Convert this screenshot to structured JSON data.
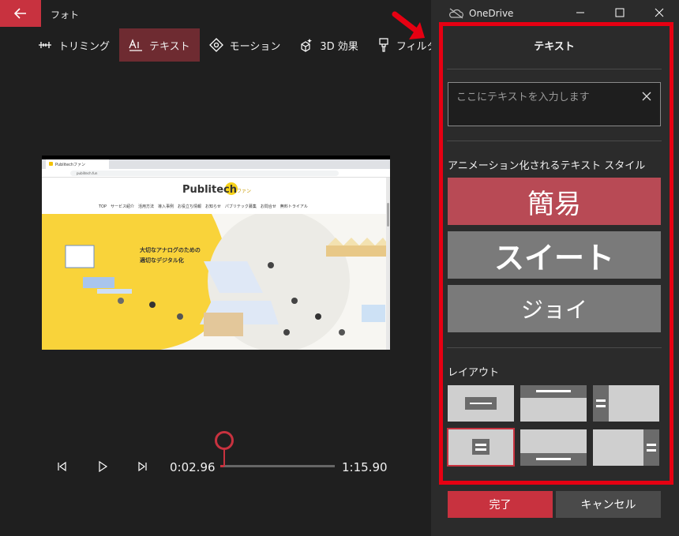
{
  "app": {
    "title": "フォト",
    "back_icon": "back-arrow-icon"
  },
  "toolbar": {
    "tools": [
      {
        "label": "トリミング",
        "icon": "trim-icon",
        "active": false
      },
      {
        "label": "テキスト",
        "icon": "text-icon",
        "active": true
      },
      {
        "label": "モーション",
        "icon": "motion-icon",
        "active": false
      },
      {
        "label": "3D 効果",
        "icon": "3d-effects-icon",
        "active": false
      },
      {
        "label": "フィルター",
        "icon": "filter-icon",
        "active": false
      }
    ]
  },
  "preview": {
    "browser_tab": "Publitechファン",
    "address": "publitech.fun",
    "site_logo": "Publitech",
    "site_logo_suffix": "ファン",
    "nav": "TOP　サービス紹介　活用方法　導入事例　お役立ち情報　お知らせ　パブリテック募集　お問合せ　無料トライアル",
    "hero_line1": "大切なアナログのための",
    "hero_line2": "適切なデジタル化"
  },
  "playback": {
    "current_time": "0:02.96",
    "total_time": "1:15.90",
    "progress": 0.039
  },
  "panel": {
    "window_title": "OneDrive",
    "title": "テキスト",
    "input_placeholder": "ここにテキストを入力します",
    "input_value": "",
    "animated_styles_label": "アニメーション化されるテキスト スタイル",
    "styles": [
      {
        "label": "簡易",
        "selected": true
      },
      {
        "label": "スイート",
        "selected": false
      },
      {
        "label": "ジョイ",
        "selected": false
      }
    ],
    "layout_label": "レイアウト",
    "done_label": "完了",
    "cancel_label": "キャンセル"
  },
  "colors": {
    "accent": "#c8323f",
    "annotation_red": "#e60012",
    "background": "#1f1f1f",
    "panel": "#2b2b2b"
  }
}
